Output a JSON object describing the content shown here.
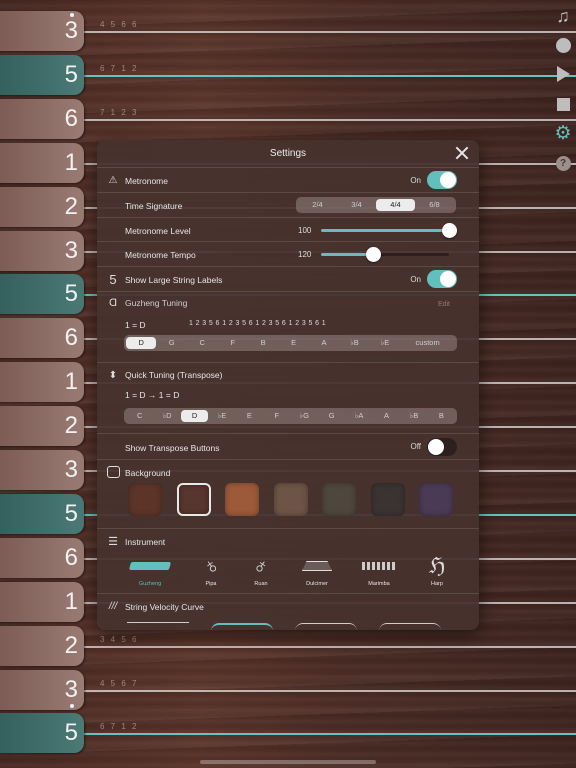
{
  "strings": [
    {
      "label": "3",
      "highlight": false,
      "notes": "4   5   6   6"
    },
    {
      "label": "5",
      "highlight": true,
      "notes": "6   7  1   2"
    },
    {
      "label": "6",
      "highlight": false,
      "notes": "7  1   2   3"
    },
    {
      "label": "1",
      "highlight": false,
      "notes": ""
    },
    {
      "label": "2",
      "highlight": false,
      "notes": ""
    },
    {
      "label": "3",
      "highlight": false,
      "notes": ""
    },
    {
      "label": "5",
      "highlight": true,
      "notes": ""
    },
    {
      "label": "6",
      "highlight": false,
      "notes": ""
    },
    {
      "label": "1",
      "highlight": false,
      "notes": ""
    },
    {
      "label": "2",
      "highlight": false,
      "notes": ""
    },
    {
      "label": "3",
      "highlight": false,
      "notes": ""
    },
    {
      "label": "5",
      "highlight": true,
      "notes": ""
    },
    {
      "label": "6",
      "highlight": false,
      "notes": ""
    },
    {
      "label": "1",
      "highlight": false,
      "notes": ""
    },
    {
      "label": "2",
      "highlight": false,
      "notes": "3   4   5   6"
    },
    {
      "label": "3",
      "highlight": false,
      "notes": "4   5   6   7"
    },
    {
      "label": "5",
      "highlight": true,
      "notes": "6   7  1   2"
    }
  ],
  "sidebar": {
    "icons": [
      "music-note-icon",
      "record-icon",
      "play-icon",
      "stop-icon",
      "gear-icon",
      "help-icon"
    ],
    "accent": "#62bfbd"
  },
  "settings": {
    "title": "Settings",
    "metronome": {
      "label": "Metronome",
      "status": "On",
      "enabled": true
    },
    "time_signature": {
      "label": "Time Signature",
      "options": [
        "2/4",
        "3/4",
        "4/4",
        "6/8"
      ],
      "selected": "4/4"
    },
    "metronome_level": {
      "label": "Metronome Level",
      "value": "100",
      "fraction": 1.0
    },
    "metronome_tempo": {
      "label": "Metronome Tempo",
      "value": "120",
      "fraction": 0.41
    },
    "large_labels": {
      "label": "Show Large String Labels",
      "status": "On",
      "enabled": true
    },
    "tuning": {
      "label": "Guzheng Tuning",
      "edit": "Edit",
      "key_text": "1 = D",
      "scale_text": "1 2 3 5 6 1 2 3 5 6 1 2 3 5 6 1 2 3 5 6 1",
      "options": [
        "D",
        "G",
        "C",
        "F",
        "B",
        "E",
        "A",
        "♭B",
        "♭E",
        "custom"
      ],
      "selected": "D"
    },
    "quick_tuning": {
      "label": "Quick Tuning  (Transpose)",
      "mapping": "1 = D → 1 = D",
      "options": [
        "C",
        "♭D",
        "D",
        "♭E",
        "E",
        "F",
        "♭G",
        "G",
        "♭A",
        "A",
        "♭B",
        "B"
      ],
      "selected": "D"
    },
    "transpose_buttons": {
      "label": "Show Transpose Buttons",
      "status": "Off",
      "enabled": false
    },
    "background": {
      "label": "Background",
      "swatches": [
        "#5c3428",
        "#56362e",
        "#9c5a3a",
        "#6d5446",
        "#4f473d",
        "#3a3332",
        "#4b3a55"
      ],
      "selected_index": 1
    },
    "instrument": {
      "label": "Instrument",
      "items": [
        "Guzheng",
        "Pipa",
        "Ruan",
        "Dulcimer",
        "Marimba",
        "Harp"
      ],
      "selected": "Guzheng"
    },
    "velocity": {
      "label": "String Velocity Curve"
    }
  }
}
